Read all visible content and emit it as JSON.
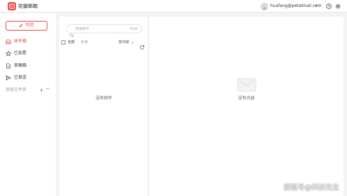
{
  "app": {
    "title": "花瓣邮箱",
    "accent_color": "#e8473f"
  },
  "header": {
    "account_email": "huafang@petalmail.com",
    "account_caret": "▾",
    "help_icon": "help-circle-icon",
    "settings_icon": "gear-icon"
  },
  "sidebar": {
    "compose_label": "写信",
    "items": [
      {
        "label": "收件箱",
        "icon": "inbox-icon",
        "active": true
      },
      {
        "label": "已加星",
        "icon": "star-icon",
        "active": false
      },
      {
        "label": "草稿箱",
        "icon": "draft-icon",
        "active": false
      },
      {
        "label": "已发送",
        "icon": "send-icon",
        "active": false
      }
    ],
    "other_folders_label": "其他文件夹",
    "add_folder_symbol": "+",
    "collapse_symbol": "^"
  },
  "mail_list": {
    "search_placeholder": "搜索邮件",
    "search_count": "0/100",
    "filter_all": "全部",
    "filter_unread": "未读",
    "sort_label": "按日期",
    "sort_caret": "▾",
    "empty_text": "没有邮件"
  },
  "mail_detail": {
    "empty_text": "没有内容"
  },
  "watermark": "搜狐号@科技先生"
}
